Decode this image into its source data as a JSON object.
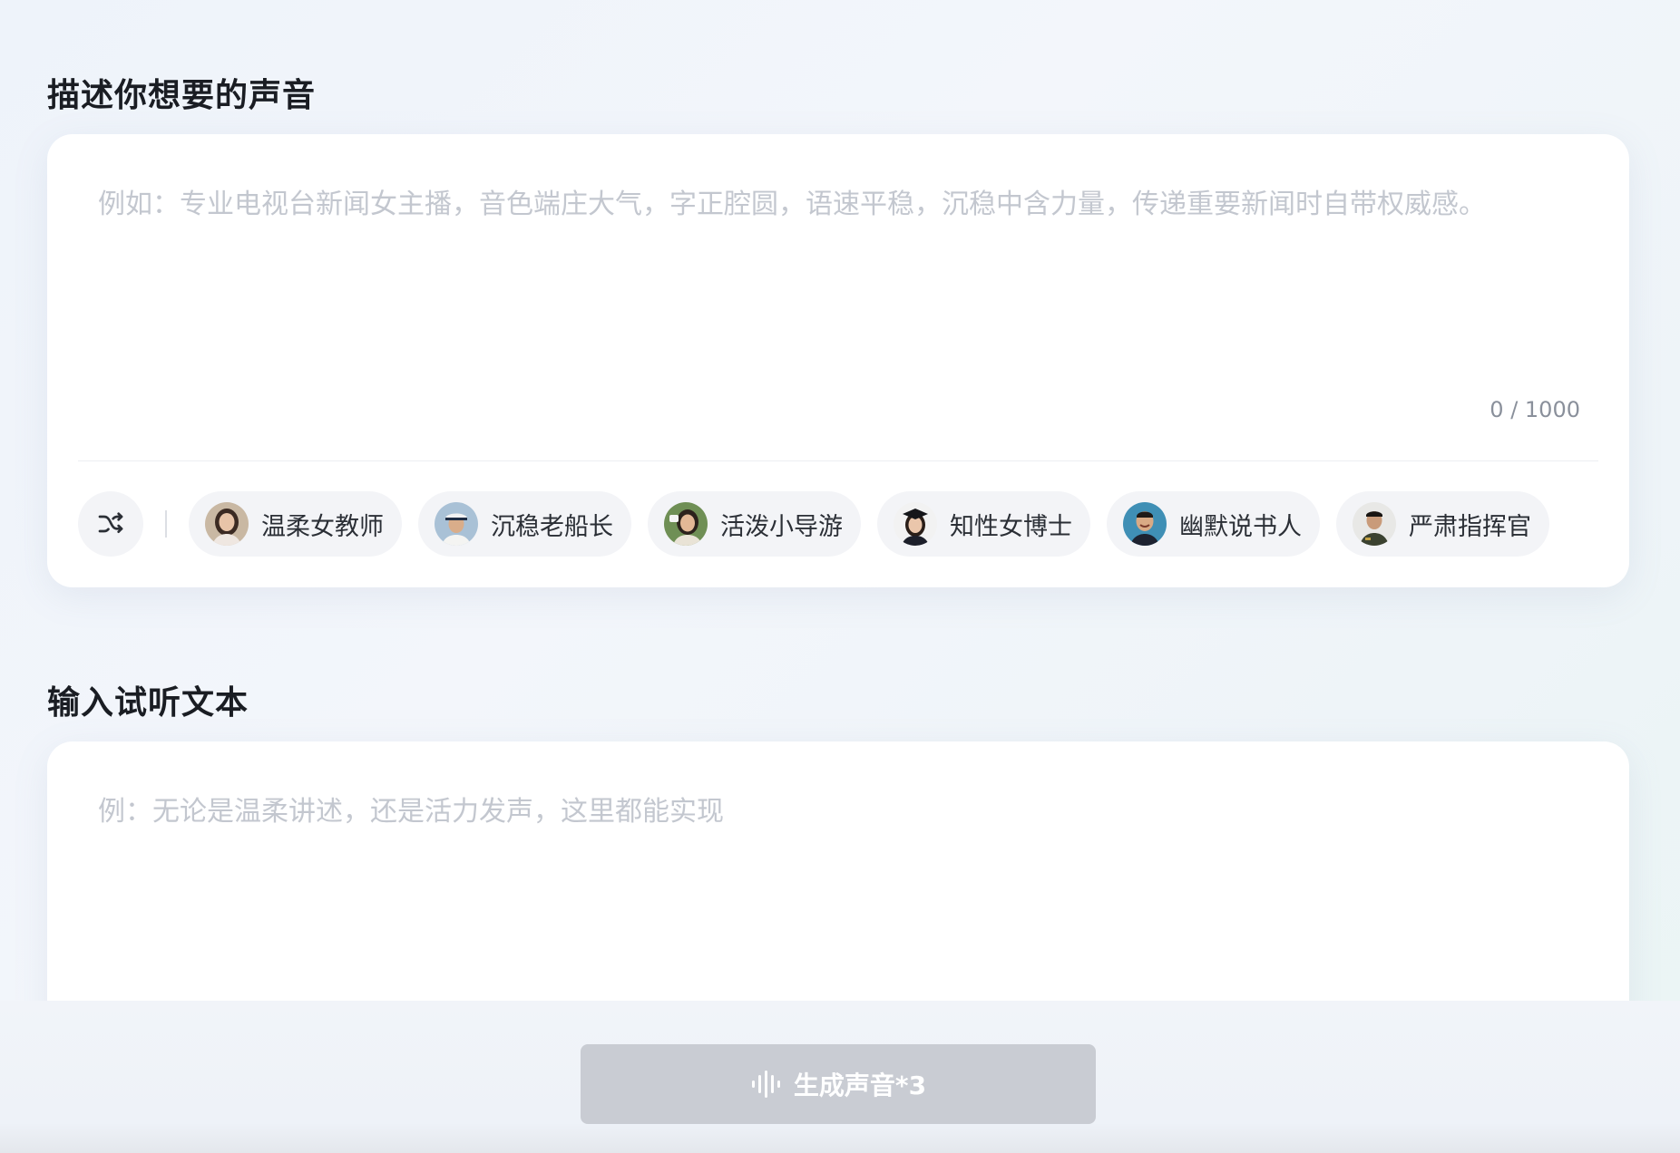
{
  "sections": {
    "describe": {
      "title": "描述你想要的声音",
      "placeholder": "例如：专业电视台新闻女主播，音色端庄大气，字正腔圆，语速平稳，沉稳中含力量，传递重要新闻时自带权威感。",
      "counter": "0 / 1000",
      "shuffle_icon": "shuffle-icon",
      "presets": [
        {
          "label": "温柔女教师",
          "icon": "avatar-gentle-teacher"
        },
        {
          "label": "沉稳老船长",
          "icon": "avatar-old-captain"
        },
        {
          "label": "活泼小导游",
          "icon": "avatar-tour-guide"
        },
        {
          "label": "知性女博士",
          "icon": "avatar-female-doctor"
        },
        {
          "label": "幽默说书人",
          "icon": "avatar-storyteller"
        },
        {
          "label": "严肃指挥官",
          "icon": "avatar-commander"
        }
      ]
    },
    "preview": {
      "title": "输入试听文本",
      "placeholder": "例：无论是温柔讲述，还是活力发声，这里都能实现"
    }
  },
  "action": {
    "generate_label": "生成声音*3",
    "icon": "soundwave-icon",
    "state": "disabled"
  },
  "colors": {
    "button_disabled": "#c9ccd3",
    "placeholder": "#c3c7cf",
    "title": "#1a1d23"
  }
}
